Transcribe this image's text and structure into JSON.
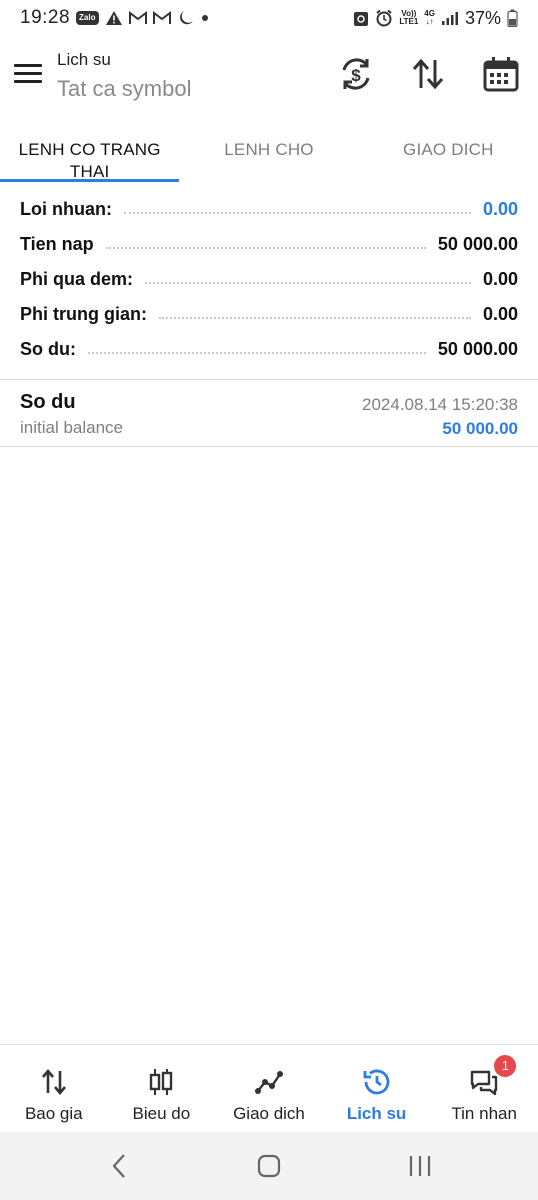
{
  "status_bar": {
    "time": "19:28",
    "zalo": "Zalo",
    "battery": "37%",
    "vol": "Vo))",
    "lte": "LTE1",
    "net": "4G"
  },
  "header": {
    "subtitle": "Lich su",
    "title": "Tat ca symbol"
  },
  "tabs": [
    {
      "label": "LENH CO TRANG THAI",
      "active": true
    },
    {
      "label": "LENH CHO",
      "active": false
    },
    {
      "label": "GIAO DICH",
      "active": false
    }
  ],
  "summary": [
    {
      "label": "Loi nhuan:",
      "value": "0.00",
      "highlight": true
    },
    {
      "label": "Tien nap",
      "value": "50 000.00",
      "highlight": false
    },
    {
      "label": "Phi qua dem:",
      "value": "0.00",
      "highlight": false
    },
    {
      "label": "Phi trung gian:",
      "value": "0.00",
      "highlight": false
    },
    {
      "label": "So du:",
      "value": "50 000.00",
      "highlight": false
    }
  ],
  "entries": [
    {
      "title": "So du",
      "subtitle": "initial balance",
      "timestamp": "2024.08.14 15:20:38",
      "amount": "50 000.00"
    }
  ],
  "bottom_nav": [
    {
      "label": "Bao gia",
      "icon": "quotes-arrows-icon",
      "active": false
    },
    {
      "label": "Bieu do",
      "icon": "candlestick-chart-icon",
      "active": false
    },
    {
      "label": "Giao dich",
      "icon": "trade-line-icon",
      "active": false
    },
    {
      "label": "Lich su",
      "icon": "history-clock-icon",
      "active": true
    },
    {
      "label": "Tin nhan",
      "icon": "chat-bubbles-icon",
      "active": false,
      "badge": "1"
    }
  ],
  "colors": {
    "accent": "#2d7be5",
    "badge": "#e5484d"
  }
}
